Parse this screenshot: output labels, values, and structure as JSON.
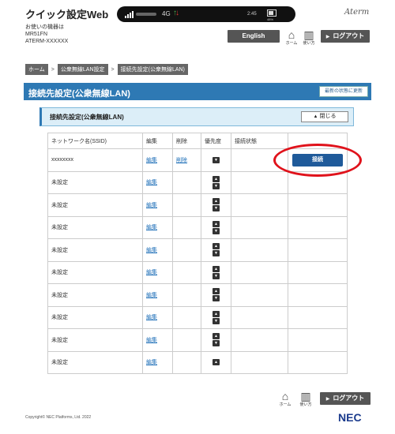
{
  "header": {
    "app_title": "クイック設定Web",
    "device_caption": "お使いの機器は",
    "device_model": "MR51FN",
    "device_id": "ATERM-XXXXXX",
    "logo_text": "Aterm",
    "status": {
      "network": "4G",
      "time": "2:45",
      "battery_pct": "48%"
    },
    "english_label": "English",
    "home_label": "ホーム",
    "help_label": "使い方",
    "logout_label": "ログアウト"
  },
  "breadcrumb": [
    "ホーム",
    "公衆無線LAN設定",
    "接続先設定(公衆無線LAN)"
  ],
  "breadcrumb_sep": ">",
  "page": {
    "title": "接続先設定(公衆無線LAN)",
    "refresh_label": "最新の状態に更新"
  },
  "panel": {
    "title": "接続先設定(公衆無線LAN)",
    "close_label": "閉じる"
  },
  "table": {
    "headers": [
      "ネットワーク名(SSID)",
      "編集",
      "削除",
      "優先度",
      "接続状態"
    ],
    "rows": [
      {
        "ssid": "xxxxxxxx",
        "edit": "編集",
        "delete": "削除",
        "connect": "接続"
      },
      {
        "ssid": "未設定",
        "edit": "編集"
      },
      {
        "ssid": "未設定",
        "edit": "編集"
      },
      {
        "ssid": "未設定",
        "edit": "編集"
      },
      {
        "ssid": "未設定",
        "edit": "編集"
      },
      {
        "ssid": "未設定",
        "edit": "編集"
      },
      {
        "ssid": "未設定",
        "edit": "編集"
      },
      {
        "ssid": "未設定",
        "edit": "編集"
      },
      {
        "ssid": "未設定",
        "edit": "編集"
      },
      {
        "ssid": "未設定",
        "edit": "編集"
      }
    ]
  },
  "footer": {
    "home_label": "ホーム",
    "help_label": "使い方",
    "logout_label": "ログアウト",
    "copyright": "Copyright© NEC Platforms, Ltd. 2022",
    "brand": "NEC"
  },
  "colors": {
    "accent": "#2e79b4",
    "button_dark": "#555555",
    "connect_button": "#1f5a9a",
    "highlight": "#e0121b"
  }
}
